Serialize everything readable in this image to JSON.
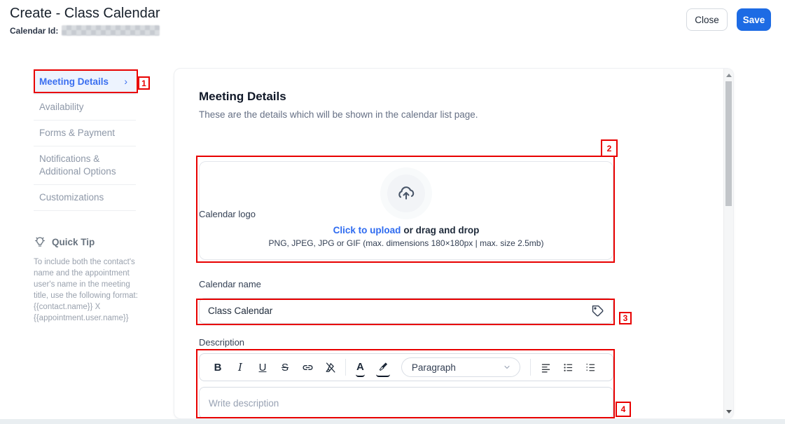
{
  "header": {
    "title": "Create - Class Calendar",
    "calendar_id_label": "Calendar Id:",
    "close_label": "Close",
    "save_label": "Save"
  },
  "sidebar": {
    "items": [
      {
        "label": "Meeting Details",
        "active": true
      },
      {
        "label": "Availability",
        "active": false
      },
      {
        "label": "Forms & Payment",
        "active": false
      },
      {
        "label": "Notifications & Additional Options",
        "active": false
      },
      {
        "label": "Customizations",
        "active": false
      }
    ],
    "quick_tip": {
      "title": "Quick Tip",
      "body": "To include both the contact's name and the appointment user's name in the meeting title, use the following format: {{contact.name}} X {{appointment.user.name}}"
    }
  },
  "main": {
    "heading": "Meeting Details",
    "subheading": "These are the details which will be shown in the calendar list page.",
    "logo": {
      "label": "Calendar logo",
      "upload_link": "Click to upload",
      "upload_rest": "or drag and drop",
      "hint": "PNG, JPEG, JPG or GIF (max. dimensions 180×180px | max. size 2.5mb)"
    },
    "name": {
      "label": "Calendar name",
      "value": "Class Calendar"
    },
    "description": {
      "label": "Description",
      "placeholder": "Write description",
      "toolbar": {
        "bold": "B",
        "italic": "I",
        "underline": "U",
        "strikethrough": "S",
        "text_color": "A",
        "paragraph": "Paragraph"
      }
    }
  },
  "annotations": {
    "labels": [
      "1",
      "2",
      "3",
      "4"
    ]
  },
  "colors": {
    "accent_blue": "#1d6be4",
    "active_item_blue": "#3a6ff0",
    "link_blue": "#2e6bf0",
    "annotation_red": "#e80000"
  }
}
